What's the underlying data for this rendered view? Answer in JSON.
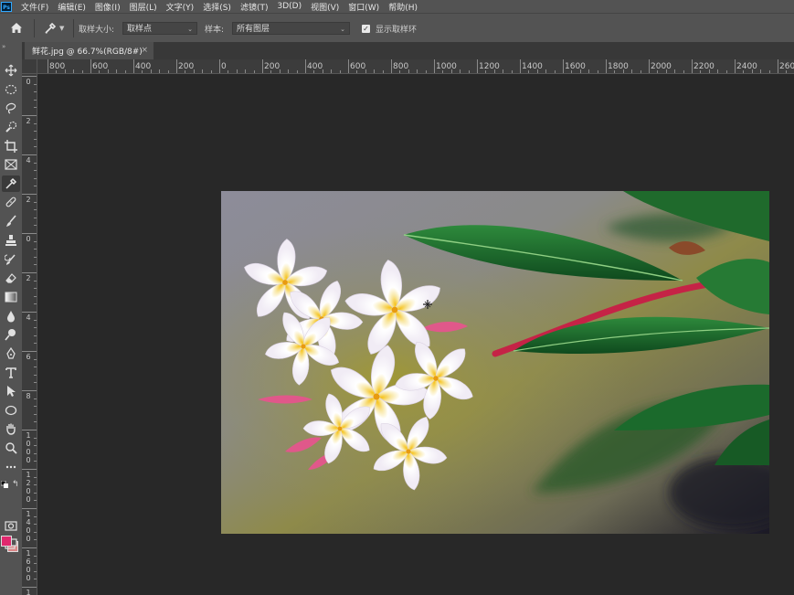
{
  "app": {
    "logo": "Ps",
    "menu": [
      "文件(F)",
      "编辑(E)",
      "图像(I)",
      "图层(L)",
      "文字(Y)",
      "选择(S)",
      "滤镜(T)",
      "3D(D)",
      "视图(V)",
      "窗口(W)",
      "帮助(H)"
    ]
  },
  "options": {
    "sample_size_label": "取样大小:",
    "sample_size_value": "取样点",
    "sample_label": "样本:",
    "sample_value": "所有图层",
    "show_ring_label": "显示取样环",
    "show_ring_checked": true
  },
  "document": {
    "tab_title": "鲜花.jpg @ 66.7%(RGB/8#)",
    "close": "×"
  },
  "rulers": {
    "horizontal": [
      "800",
      "600",
      "400",
      "200",
      "0",
      "200",
      "400",
      "600",
      "800",
      "1000",
      "1200",
      "1400",
      "1600",
      "1800",
      "2000",
      "2200",
      "2400",
      "260"
    ],
    "vertical": [
      "0",
      "2",
      "4",
      "2",
      "0",
      "2",
      "4",
      "6",
      "8",
      "1000",
      "1200",
      "1400",
      "1600",
      "18"
    ]
  },
  "colors": {
    "foreground": "#e0286e",
    "background": "#d98687",
    "accent": "#31a8ff"
  },
  "tools": [
    "move-tool-icon",
    "marquee-tool-icon",
    "lasso-tool-icon",
    "quick-select-tool-icon",
    "crop-tool-icon",
    "frame-tool-icon",
    "eyedropper-tool-icon",
    "healing-brush-icon",
    "brush-tool-icon",
    "clone-stamp-icon",
    "history-brush-icon",
    "eraser-tool-icon",
    "gradient-tool-icon",
    "blur-tool-icon",
    "dodge-tool-icon",
    "pen-tool-icon",
    "type-tool-icon",
    "path-select-icon",
    "ellipse-shape-icon",
    "hand-tool-icon",
    "zoom-tool-icon",
    "more-tools-icon"
  ]
}
